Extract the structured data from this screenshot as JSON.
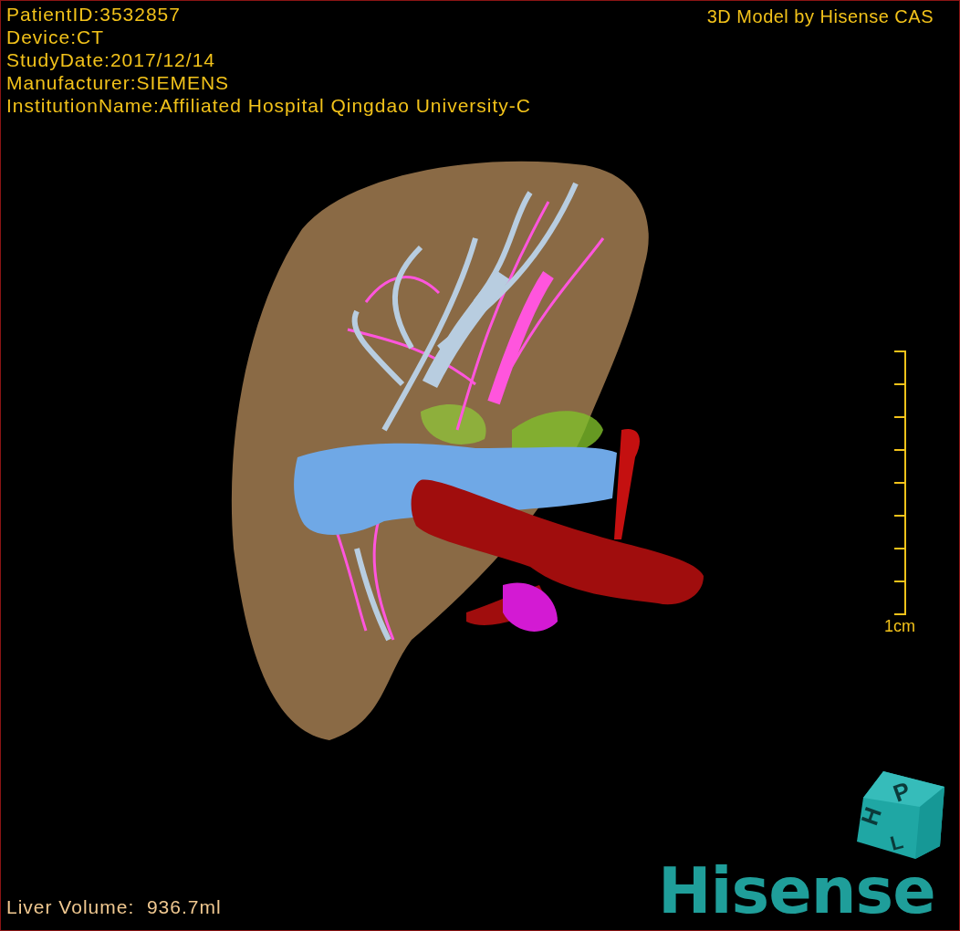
{
  "info_lines": [
    "PatientID:3532857",
    "Device:CT",
    "StudyDate:2017/12/14",
    "Manufacturer:SIEMENS",
    "InstitutionName:Affiliated Hospital Qingdao University-C"
  ],
  "title": "3D Model by Hisense CAS",
  "scale_bar": {
    "label": "1cm"
  },
  "liver_volume": "Liver Volume:  936.7ml",
  "orientation_cube": {
    "faces": [
      "H",
      "P",
      "L"
    ]
  },
  "logo": "Hisense"
}
